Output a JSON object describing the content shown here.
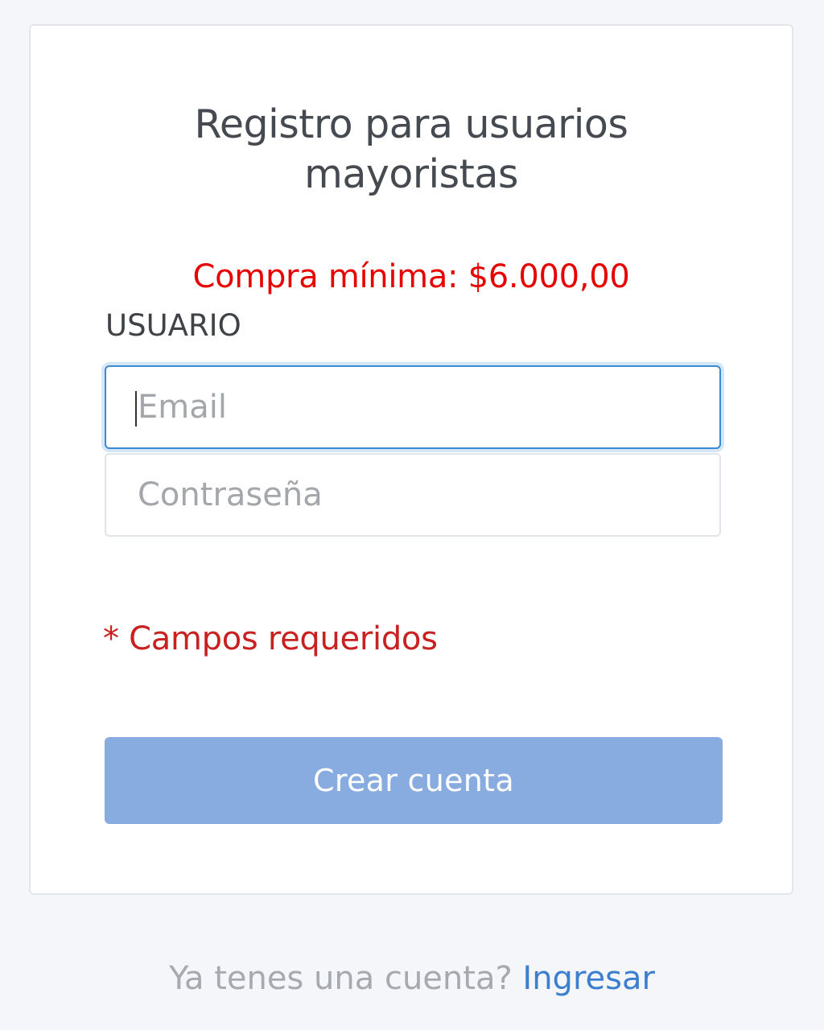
{
  "form": {
    "title_line1": "Registro para usuarios",
    "title_line2": "mayoristas",
    "min_purchase": "Compra mínima: $6.000,00",
    "user_label": "USUARIO",
    "email_placeholder": "Email",
    "password_placeholder": "Contraseña",
    "required_note": "* Campos requeridos",
    "create_button_label": "Crear cuenta"
  },
  "footer": {
    "prompt": "Ya tenes una cuenta?",
    "login_link": "Ingresar"
  },
  "colors": {
    "page_background": "#f4f6f9",
    "accent_red": "#e60000",
    "required_red": "#c92020",
    "button_blue": "#88abe0",
    "link_blue": "#3c7fd0",
    "focus_border": "#3b8ad6"
  }
}
